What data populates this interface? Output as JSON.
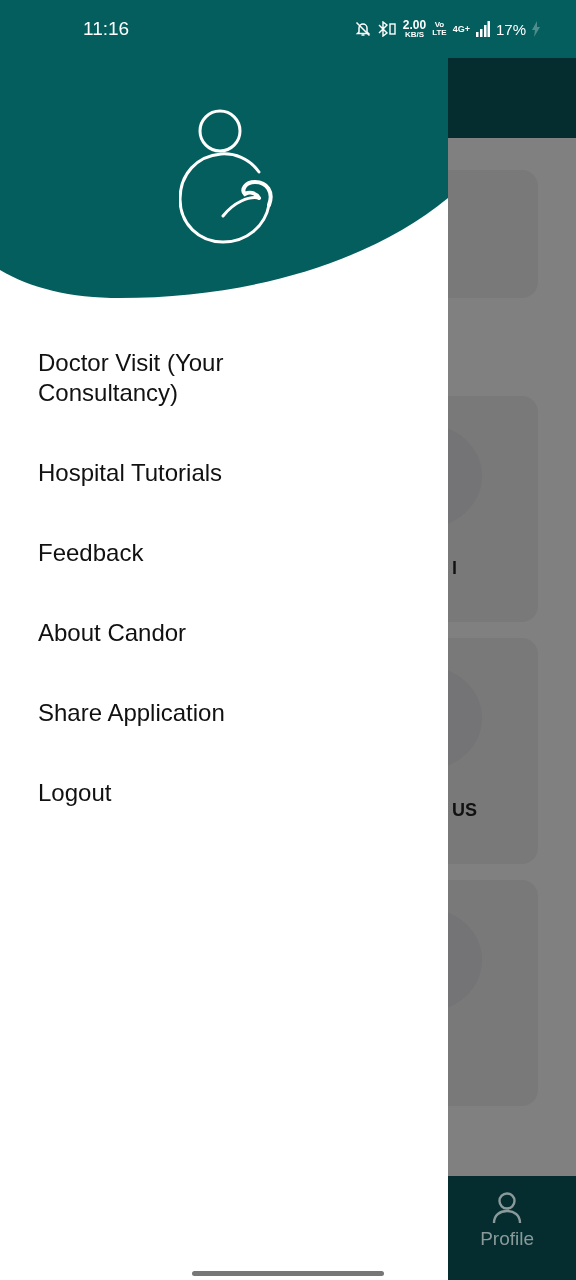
{
  "status_bar": {
    "time": "11:16",
    "speed_value": "2.00",
    "speed_unit": "KB/S",
    "volte_top": "Vo",
    "volte_bottom": "LTE",
    "network": "4G+",
    "battery": "17%"
  },
  "background": {
    "card_texts": [
      "l",
      "US"
    ],
    "bottom_nav": {
      "label": "Profile"
    }
  },
  "drawer": {
    "menu": [
      {
        "label": "Doctor Visit (Your Consultancy)"
      },
      {
        "label": "Hospital Tutorials"
      },
      {
        "label": "Feedback"
      },
      {
        "label": "About Candor"
      },
      {
        "label": "Share Application"
      },
      {
        "label": "Logout"
      }
    ]
  }
}
